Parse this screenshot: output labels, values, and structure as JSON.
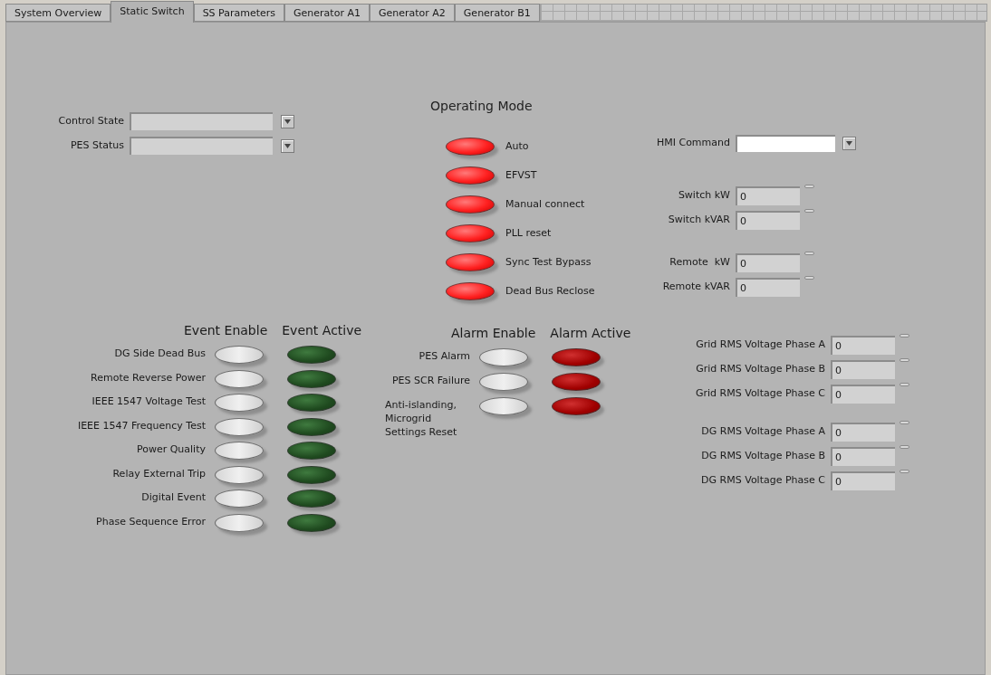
{
  "tabs": [
    {
      "label": "System Overview",
      "selected": false
    },
    {
      "label": "Static Switch",
      "selected": true
    },
    {
      "label": "SS Parameters",
      "selected": false
    },
    {
      "label": "Generator A1",
      "selected": false
    },
    {
      "label": "Generator A2",
      "selected": false
    },
    {
      "label": "Generator B1",
      "selected": false
    }
  ],
  "status_fields": [
    {
      "label": "Control State"
    },
    {
      "label": "PES Status"
    }
  ],
  "operating_mode": {
    "title": "Operating Mode",
    "modes": [
      {
        "label": "Auto",
        "on": true
      },
      {
        "label": "EFVST",
        "on": true
      },
      {
        "label": "Manual connect",
        "on": true
      },
      {
        "label": "PLL reset",
        "on": true
      },
      {
        "label": "Sync Test Bypass",
        "on": true
      },
      {
        "label": "Dead Bus Reclose",
        "on": true
      }
    ]
  },
  "hmi_command": {
    "label": "HMI Command"
  },
  "power_groups": [
    {
      "readings": [
        {
          "label": "Switch kW",
          "value": "0"
        },
        {
          "label": "Switch kVAR",
          "value": "0"
        }
      ]
    },
    {
      "readings": [
        {
          "label": "Remote  kW",
          "value": "0"
        },
        {
          "label": "Remote kVAR",
          "value": "0"
        }
      ]
    }
  ],
  "events": {
    "enable_title": "Event Enable",
    "active_title": "Event Active",
    "items": [
      {
        "label": "DG Side Dead Bus",
        "enabled": false,
        "active": false
      },
      {
        "label": "Remote Reverse Power",
        "enabled": false,
        "active": false
      },
      {
        "label": "IEEE 1547 Voltage Test",
        "enabled": false,
        "active": false
      },
      {
        "label": "IEEE 1547 Frequency Test",
        "enabled": false,
        "active": false
      },
      {
        "label": "Power Quality",
        "enabled": false,
        "active": false
      },
      {
        "label": "Relay External Trip",
        "enabled": false,
        "active": false
      },
      {
        "label": "Digital Event",
        "enabled": false,
        "active": false
      },
      {
        "label": "Phase Sequence Error",
        "enabled": false,
        "active": false
      }
    ]
  },
  "alarms": {
    "enable_title": "Alarm Enable",
    "active_title": "Alarm Active",
    "items": [
      {
        "label": "PES Alarm",
        "enabled": false,
        "active": false
      },
      {
        "label": "PES SCR Failure",
        "enabled": false,
        "active": false
      },
      {
        "label": "Anti-islanding, Microgrid Settings Reset",
        "enabled": false,
        "active": false
      }
    ]
  },
  "voltage_groups": [
    {
      "readings": [
        {
          "label": "Grid RMS Voltage Phase A",
          "value": "0"
        },
        {
          "label": "Grid RMS Voltage Phase B",
          "value": "0"
        },
        {
          "label": "Grid RMS Voltage Phase C",
          "value": "0"
        }
      ]
    },
    {
      "readings": [
        {
          "label": "DG RMS Voltage Phase A",
          "value": "0"
        },
        {
          "label": "DG RMS Voltage Phase B",
          "value": "0"
        },
        {
          "label": "DG RMS Voltage Phase C",
          "value": "0"
        }
      ]
    }
  ]
}
